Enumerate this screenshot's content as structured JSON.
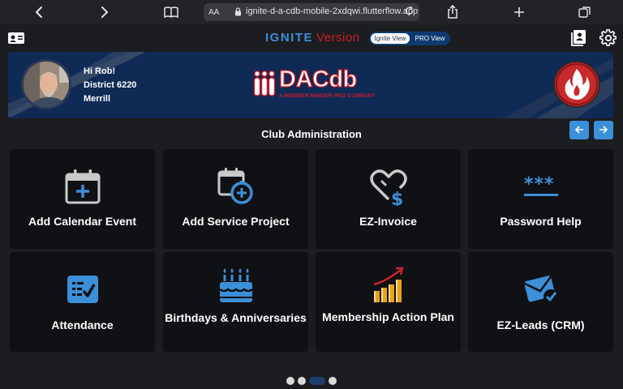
{
  "browser": {
    "text_size_label": "AA",
    "url": "ignite-d-a-cdb-mobile-2xdqwi.flutterflow.app"
  },
  "app_bar": {
    "title_word1": "IGNITE",
    "title_word2": "Version",
    "view_toggle": {
      "selected": "Ignite View",
      "other": "PRO View"
    }
  },
  "banner": {
    "greeting": "Hi Rob!",
    "district": "District 6220",
    "club": "Merrill",
    "logo_name": "DACdb",
    "logo_tagline": "A MEMBER MINDER PRO COMPANY"
  },
  "section": {
    "title": "Club Administration"
  },
  "tiles": [
    {
      "label": "Add Calendar Event",
      "icon": "calendar-plus-icon"
    },
    {
      "label": "Add Service Project",
      "icon": "calendar-clock-plus-icon"
    },
    {
      "label": "EZ-Invoice",
      "icon": "heart-dollar-icon"
    },
    {
      "label": "Password Help",
      "icon": "password-icon"
    },
    {
      "label": "Attendance",
      "icon": "checklist-icon"
    },
    {
      "label": "Birthdays & Anniversaries",
      "icon": "birthday-cake-icon"
    },
    {
      "label": "Membership Action Plan",
      "icon": "growth-chart-icon"
    },
    {
      "label": "EZ-Leads (CRM)",
      "icon": "mail-check-icon"
    }
  ],
  "pager": {
    "pages": 4,
    "current": 3
  },
  "colors": {
    "accent": "#3c8fd9",
    "brand_red": "#d01c2a",
    "banner": "#0f2a55",
    "tile": "#101114"
  }
}
